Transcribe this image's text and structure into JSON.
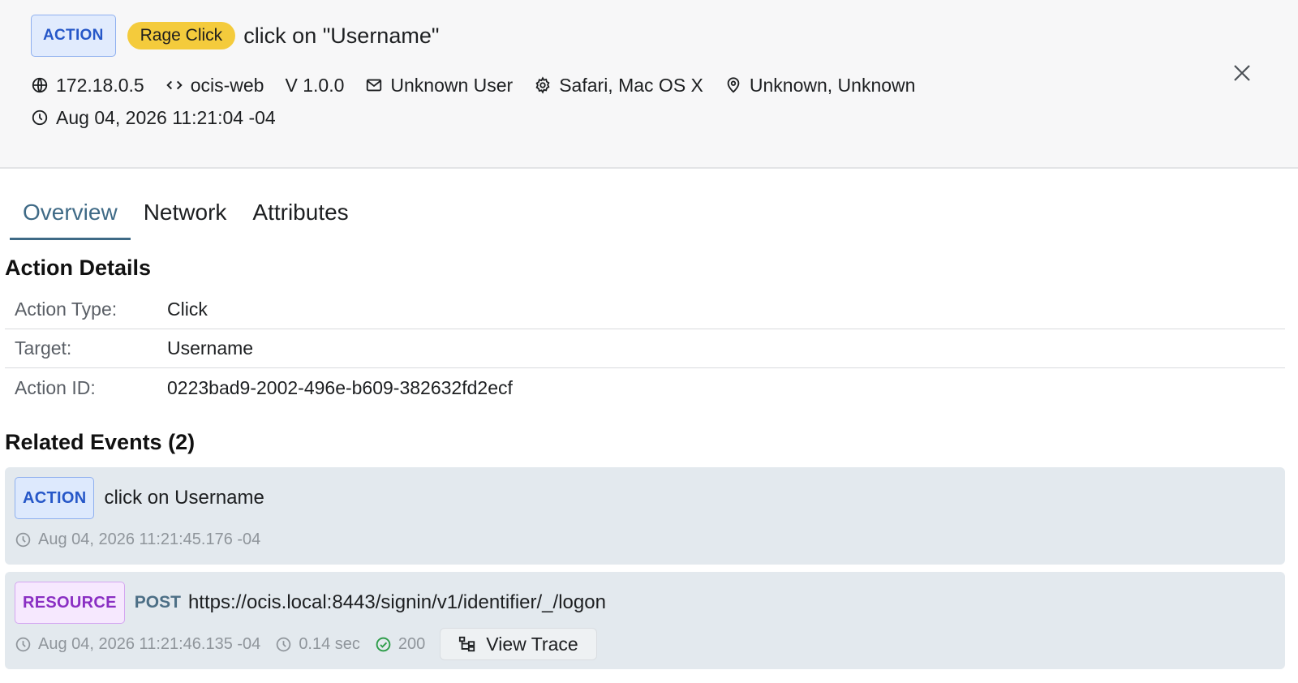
{
  "header": {
    "badge": "ACTION",
    "tag": "Rage Click",
    "title": "click on \"Username\"",
    "ip": "172.18.0.5",
    "app": "ocis-web",
    "version": "V 1.0.0",
    "user": "Unknown User",
    "browser": "Safari, Mac OS X",
    "location": "Unknown, Unknown",
    "timestamp": "Aug 04, 2026 11:21:04 -04",
    "icons": [
      "globe-icon",
      "code-icon",
      "mail-icon",
      "gear-icon",
      "location-pin-icon",
      "clock-icon",
      "close-icon"
    ]
  },
  "tabs": [
    {
      "label": "Overview",
      "active": true
    },
    {
      "label": "Network",
      "active": false
    },
    {
      "label": "Attributes",
      "active": false
    }
  ],
  "details": {
    "title": "Action Details",
    "rows": [
      {
        "label": "Action Type:",
        "value": "Click"
      },
      {
        "label": "Target:",
        "value": "Username"
      },
      {
        "label": "Action ID:",
        "value": "0223bad9-2002-496e-b609-382632fd2ecf"
      }
    ]
  },
  "related": {
    "title": "Related Events (2)",
    "events": [
      {
        "badge": "ACTION",
        "title": "click on Username",
        "time": "Aug 04, 2026 11:21:45.176 -04"
      },
      {
        "badge": "RESOURCE",
        "method": "POST",
        "url": "https://ocis.local:8443/signin/v1/identifier/_/logon",
        "time": "Aug 04, 2026 11:21:46.135 -04",
        "duration": "0.14 sec",
        "status": "200",
        "button": "View Trace"
      }
    ]
  },
  "colors": {
    "action_badge": "#2657c8",
    "resource_badge": "#8a2fc3",
    "rage_badge": "#f4cb3c",
    "active_tab": "#3f6a86",
    "status_ok": "#2e9d4a"
  }
}
